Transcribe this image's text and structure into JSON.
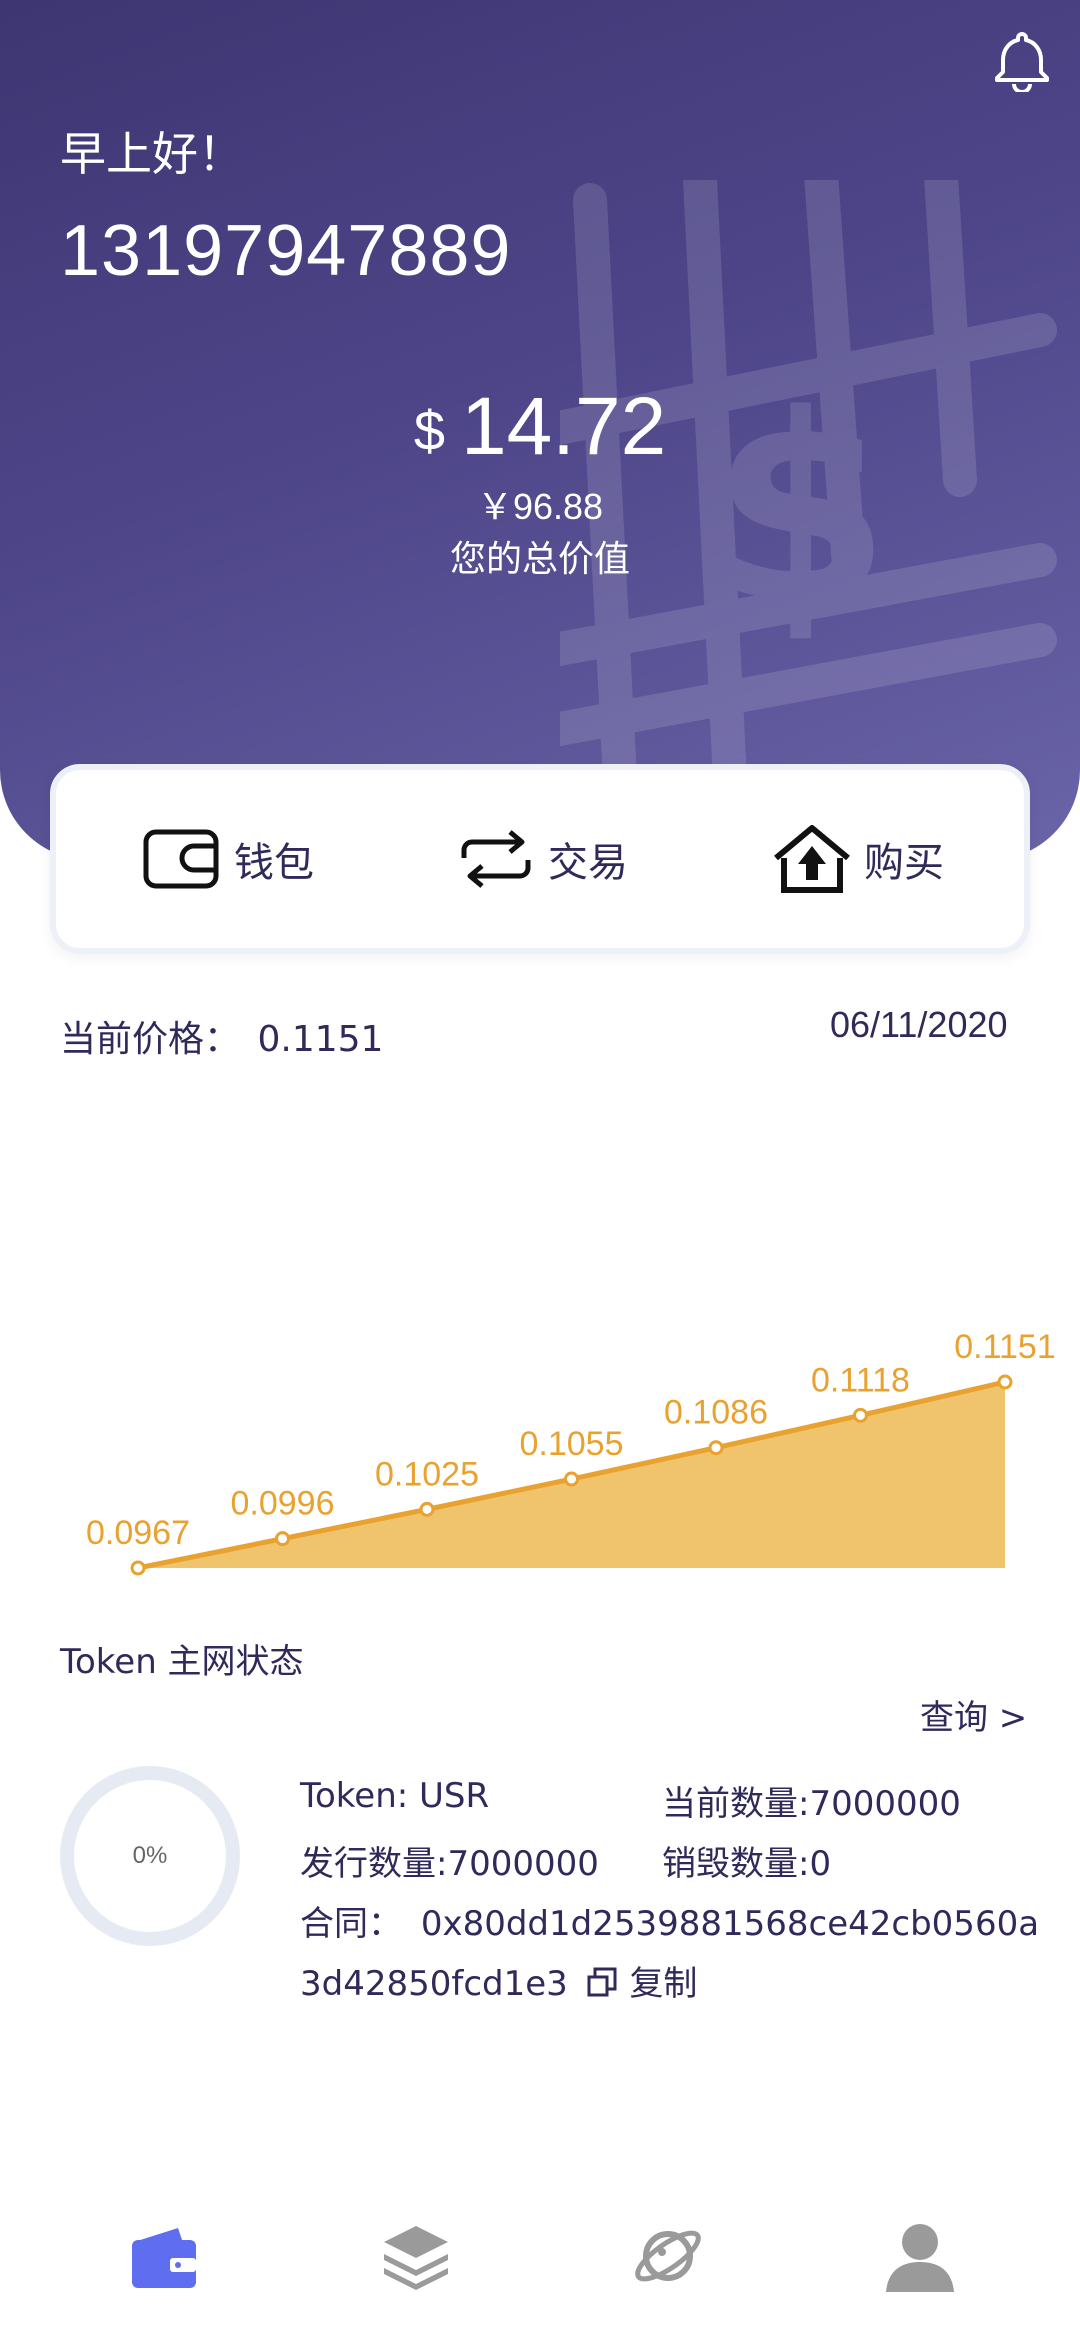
{
  "header": {
    "greeting": "早上好！",
    "phone": "13197947889",
    "usd_symbol": "$",
    "usd_value": "14.72",
    "cny_value": "￥96.88",
    "total_caption": "您的总价值"
  },
  "actions": [
    {
      "label": "钱包",
      "icon": "wallet-icon"
    },
    {
      "label": "交易",
      "icon": "exchange-icon"
    },
    {
      "label": "购买",
      "icon": "buy-upload-icon"
    }
  ],
  "price": {
    "label": "当前价格：",
    "value": "0.1151",
    "date": "06/11/2020"
  },
  "chart_data": {
    "type": "area",
    "values": [
      0.0967,
      0.0996,
      0.1025,
      0.1055,
      0.1086,
      0.1118,
      0.1151
    ],
    "data_labels": [
      "0.0967",
      "0.0996",
      "0.1025",
      "0.1055",
      "0.1086",
      "0.1118",
      "0.1151"
    ],
    "color": "#f0c46c",
    "line_color": "#e9a22f",
    "label_color": "#e9a22f"
  },
  "token_status": {
    "title": "Token 主网状态",
    "query_link": "查询 >",
    "progress_label": "0%",
    "progress": 0,
    "token": "Token: USR",
    "current_amount": "当前数量:7000000",
    "issued_amount": "发行数量:7000000",
    "burned_amount": "销毁数量:0",
    "contract_label": "合同：",
    "contract_line1": "0x80dd1d2539881568ce42cb0560a",
    "contract_line2": "3d42850fcd1e3",
    "copy_label": "复制"
  },
  "tabbar": [
    {
      "icon": "wallet-tab-icon",
      "active": true
    },
    {
      "icon": "layers-tab-icon",
      "active": false
    },
    {
      "icon": "planet-tab-icon",
      "active": false
    },
    {
      "icon": "profile-tab-icon",
      "active": false
    }
  ],
  "colors": {
    "accent": "#5f6df0",
    "hero_start": "#3e3672",
    "hero_end": "#6a64a8",
    "text_dark": "#2f2a5a"
  }
}
